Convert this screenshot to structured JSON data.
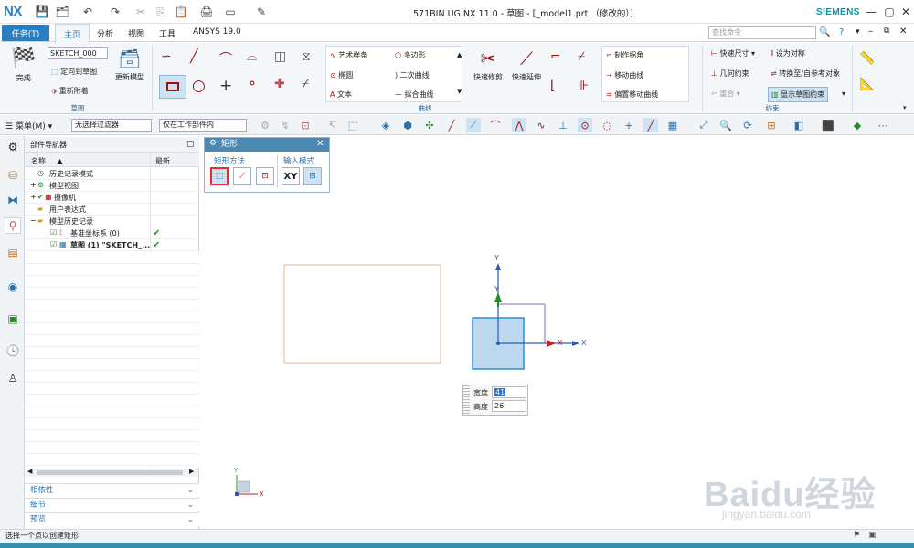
{
  "app": {
    "logo": "NX",
    "window_title": "571BIN UG NX 11.0 - 草图 - [_model1.prt （修改的）]",
    "brand": "SIEMENS"
  },
  "tabs": [
    {
      "label": "任务(T)"
    },
    {
      "label": "主页"
    },
    {
      "label": "分析"
    },
    {
      "label": "视图"
    },
    {
      "label": "工具"
    },
    {
      "label": "ANSYS 19.0"
    }
  ],
  "search_placeholder": "查找命令",
  "ribbon": {
    "finish_label": "完成",
    "sketch_select": "SKETCH_000",
    "orient_label": "定向到草图",
    "reattach_label": "重新附着",
    "update_model_label": "更新模型",
    "sketch_group_label": "草图",
    "curve_items": [
      "艺术样条",
      "多边形",
      "椭圆",
      "二次曲线",
      "文本",
      "拟合曲线"
    ],
    "quick_trim": "快速修剪",
    "quick_extend": "快速延伸",
    "make_corner": "制作拐角",
    "move_curve": "移动曲线",
    "offset_move_curve": "偏置移动曲线",
    "curve_group_label": "曲线",
    "quick_dim": "快速尺寸",
    "set_symmetric": "设为对称",
    "geo_constraint": "几何约束",
    "convert_ref": "转换至/自参考对象",
    "overlap": "重合",
    "show_constraints": "显示草图约束",
    "constraint_group_label": "约束"
  },
  "toolbar2": {
    "menu_label": "菜单(M)",
    "filter_value": "无选择过滤器",
    "scope_value": "仅在工作部件内"
  },
  "navigator": {
    "title": "部件导航器",
    "col_name": "名称",
    "col_latest": "最新",
    "rows": [
      {
        "label": "历史记录模式",
        "latest": ""
      },
      {
        "label": "模型视图",
        "latest": ""
      },
      {
        "label": "摄像机",
        "latest": ""
      },
      {
        "label": "用户表达式",
        "latest": ""
      },
      {
        "label": "模型历史记录",
        "latest": ""
      },
      {
        "label": "基准坐标系 (0)",
        "latest": "✔"
      },
      {
        "label": "草图 (1) \"SKETCH_...",
        "latest": "✔"
      }
    ],
    "panels": [
      "相依性",
      "细节",
      "预览"
    ]
  },
  "dialog": {
    "title": "矩形",
    "method_label": "矩形方法",
    "input_label": "输入模式",
    "xy_label": "XY"
  },
  "dims": {
    "width_label": "宽度",
    "width_value": "41",
    "height_label": "高度",
    "height_value": "26"
  },
  "axes": {
    "x": "X",
    "y": "Y"
  },
  "status_text": "选择一个点以创建矩形",
  "watermark": {
    "main": "Baidu经验",
    "sub": "jingyan.baidu.com"
  },
  "colors": {
    "accent": "#2a7fc1",
    "brand": "#0098a6",
    "selected_box": "#2a8fd6",
    "rect_outline": "#f0b48a"
  }
}
